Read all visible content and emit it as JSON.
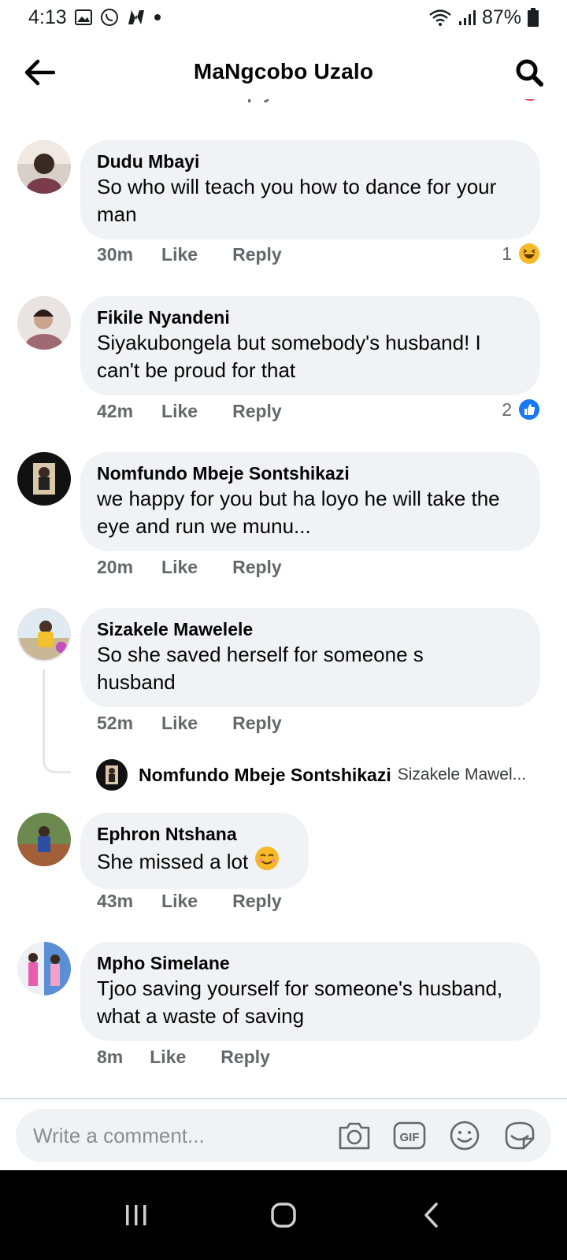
{
  "status_bar": {
    "time": "4:13",
    "battery": "87%"
  },
  "header": {
    "title": "MaNgcobo Uzalo"
  },
  "previous_comment_actions": {
    "time": "30m",
    "like": "Like",
    "reply": "Reply"
  },
  "comments": [
    {
      "name": "Dudu Mbayi",
      "text_lines": [
        "So who will teach you how to dance for your",
        "man"
      ],
      "time": "30m",
      "like": "Like",
      "reply": "Reply",
      "reaction_count": "1",
      "reaction": "haha"
    },
    {
      "name": "Fikile Nyandeni",
      "text_lines": [
        "Siyakubongela but  somebody's husband! I",
        "can't be proud for that"
      ],
      "time": "42m",
      "like": "Like",
      "reply": "Reply",
      "reaction_count": "2",
      "reaction": "like"
    },
    {
      "name": "Nomfundo Mbeje Sontshikazi",
      "text_lines": [
        "we happy for you but ha loyo he will take the",
        "eye and run we munu..."
      ],
      "time": "20m",
      "like": "Like",
      "reply": "Reply"
    },
    {
      "name": "Sizakele Mawelele",
      "text_lines": [
        "So she saved herself for someone s",
        "husband"
      ],
      "time": "52m",
      "like": "Like",
      "reply": "Reply"
    },
    {
      "name": "Ephron Ntshana",
      "text_lines": [
        "She missed a lot"
      ],
      "time": "43m",
      "like": "Like",
      "reply": "Reply"
    },
    {
      "name": "Mpho Simelane",
      "text_lines": [
        "Tjoo saving yourself for someone's husband,",
        "what a waste of saving"
      ],
      "time": "8m",
      "like": "Like",
      "reply": "Reply"
    }
  ],
  "reply_preview": {
    "name": "Nomfundo Mbeje Sontshikazi",
    "snippet": "Sizakele Mawel..."
  },
  "composer": {
    "placeholder": "Write a comment...",
    "gif_label": "GIF"
  },
  "colors": {
    "bubble": "#f0f2f5",
    "meta_text": "#65676b",
    "like_blue": "#1877f2",
    "haha_yellow": "#f7b928"
  }
}
